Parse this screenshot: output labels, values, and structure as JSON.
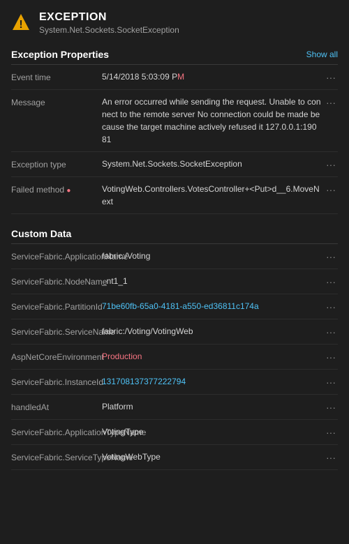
{
  "header": {
    "title": "EXCEPTION",
    "subtitle": "System.Net.Sockets.SocketException",
    "icon_alt": "warning-triangle"
  },
  "exception_properties": {
    "section_title": "Exception Properties",
    "show_all_label": "Show all",
    "rows": [
      {
        "key": "Event time",
        "value_plain": "5/14/2018 5:03:09 P",
        "value_highlight": "M",
        "value_after": ""
      },
      {
        "key": "Message",
        "value_plain": "An error occurred while sending the request. Unable to connect to the remote server No connection could be made because the target machine actively refused it 127.0.0.1:19081",
        "value_highlight": "",
        "value_after": ""
      },
      {
        "key": "Exception type",
        "value_plain": "System.Net.Sockets.SocketException",
        "value_highlight": "",
        "value_after": ""
      },
      {
        "key": "Failed method",
        "value_plain": "VotingWeb.Controllers.VotesController+<Put>d__6.MoveNext",
        "value_highlight": "",
        "value_after": "",
        "key_highlight": true
      }
    ]
  },
  "custom_data": {
    "section_title": "Custom Data",
    "rows": [
      {
        "key": "ServiceFabric.ApplicationName",
        "value_plain": "fabric:/Voting",
        "value_suffix_highlight": "",
        "link": false
      },
      {
        "key": "ServiceFabric.NodeName",
        "value_plain": "_nt1_1",
        "link": false
      },
      {
        "key": "ServiceFabric.PartitionId",
        "value_plain": "71be60fb-65a0-4181-a550-ed36811c174a",
        "link": true
      },
      {
        "key": "ServiceFabric.ServiceName",
        "value_plain": "fabric:/Voting/VotingWeb",
        "link": false
      },
      {
        "key": "AspNetCoreEnvironment",
        "value_plain": "Production",
        "value_highlight": true
      },
      {
        "key": "ServiceFabric.InstanceId",
        "value_plain": "131708137377222794",
        "link": true
      },
      {
        "key": "handledAt",
        "value_plain": "Platform",
        "link": false
      },
      {
        "key": "ServiceFabric.ApplicationTypeName",
        "value_plain": "VotingType",
        "link": false
      },
      {
        "key": "ServiceFabric.ServiceTypeName",
        "value_plain": "VotingWebType",
        "link": false
      }
    ]
  },
  "more_button_label": "···"
}
